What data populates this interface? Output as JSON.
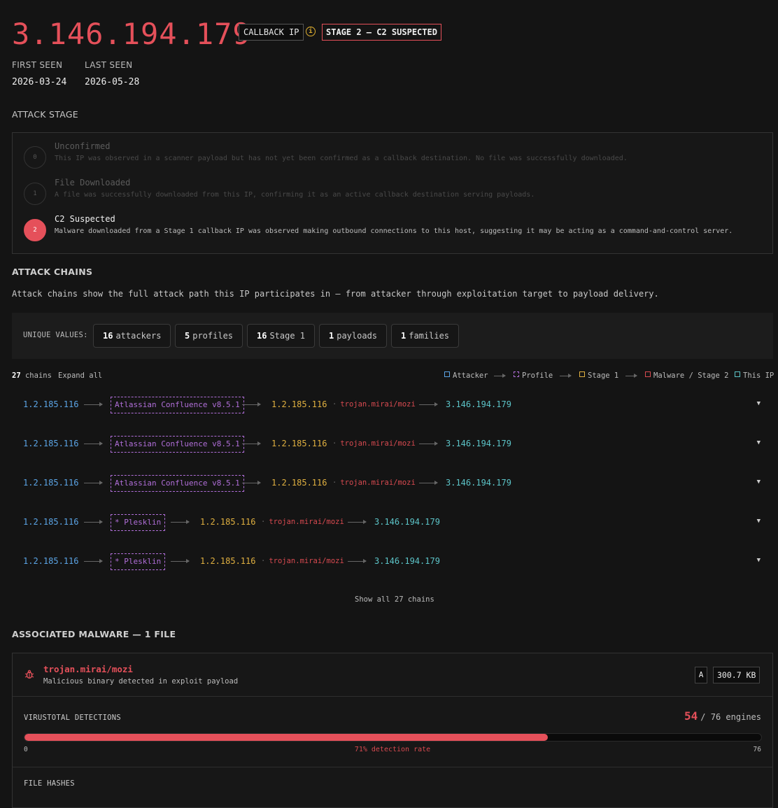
{
  "header": {
    "ip": "3.146.194.179",
    "type_tag": "CALLBACK IP",
    "stage_tag": "STAGE 2 — C2 SUSPECTED",
    "first_seen_label": "FIRST SEEN",
    "first_seen": "2026-03-24",
    "last_seen_label": "LAST SEEN",
    "last_seen": "2026-05-28"
  },
  "attack_stage": {
    "title": "ATTACK STAGE",
    "stages": [
      {
        "num": "0",
        "name": "Unconfirmed",
        "desc": "This IP was observed in a scanner payload but has not yet been confirmed as a callback destination. No file was successfully downloaded."
      },
      {
        "num": "1",
        "name": "File Downloaded",
        "desc": "A file was successfully downloaded from this IP, confirming it as an active callback destination serving payloads."
      },
      {
        "num": "2",
        "name": "C2 Suspected",
        "desc": "Malware downloaded from a Stage 1 callback IP was observed making outbound connections to this host, suggesting it may be acting as a command-and-control server."
      }
    ],
    "active_stage": 2
  },
  "attack_chains": {
    "title": "ATTACK CHAINS",
    "description": "Attack chains show the full attack path this IP participates in — from attacker through exploitation target to payload delivery.",
    "unique_label": "UNIQUE VALUES:",
    "unique": [
      {
        "count": "16",
        "label": "attackers"
      },
      {
        "count": "5",
        "label": "profiles"
      },
      {
        "count": "16",
        "label": "Stage 1"
      },
      {
        "count": "1",
        "label": "payloads"
      },
      {
        "count": "1",
        "label": "families"
      }
    ],
    "chain_count": "27",
    "chain_count_label": "chains",
    "expand_all": "Expand all",
    "legend": [
      "Attacker",
      "Profile",
      "Stage 1",
      "Malware / Stage 2",
      "This IP"
    ],
    "chains": [
      {
        "attacker": "1.2.185.116",
        "profile": "Atlassian Confluence v8.5.1",
        "stage1": "1.2.185.116",
        "malware": "trojan.mirai/mozi",
        "this_ip": "3.146.194.179"
      },
      {
        "attacker": "1.2.185.116",
        "profile": "Atlassian Confluence v8.5.1",
        "stage1": "1.2.185.116",
        "malware": "trojan.mirai/mozi",
        "this_ip": "3.146.194.179"
      },
      {
        "attacker": "1.2.185.116",
        "profile": "Atlassian Confluence v8.5.1",
        "stage1": "1.2.185.116",
        "malware": "trojan.mirai/mozi",
        "this_ip": "3.146.194.179"
      },
      {
        "attacker": "1.2.185.116",
        "profile": "* Plesklin",
        "stage1": "1.2.185.116",
        "malware": "trojan.mirai/mozi",
        "this_ip": "3.146.194.179"
      },
      {
        "attacker": "1.2.185.116",
        "profile": "* Plesklin",
        "stage1": "1.2.185.116",
        "malware": "trojan.mirai/mozi",
        "this_ip": "3.146.194.179"
      }
    ],
    "show_all": "Show all 27 chains"
  },
  "malware": {
    "title": "ASSOCIATED MALWARE — 1 FILE",
    "name": "trojan.mirai/mozi",
    "subtitle": "Malicious binary detected in exploit payload",
    "arch_badge": "A",
    "size": "300.7 KB",
    "vt_label": "VIRUSTOTAL DETECTIONS",
    "vt_detected": "54",
    "vt_total_text": "/ 76 engines",
    "vt_fraction": 0.71,
    "vt_min": "0",
    "vt_max": "76",
    "vt_rate": "71% detection rate",
    "hashes_label": "FILE HASHES"
  },
  "colors": {
    "accent_red": "#e5505a",
    "attacker": "#5ba4e5",
    "profile": "#b06ed8",
    "stage1": "#e0b040",
    "this_ip": "#5cc4c8"
  }
}
